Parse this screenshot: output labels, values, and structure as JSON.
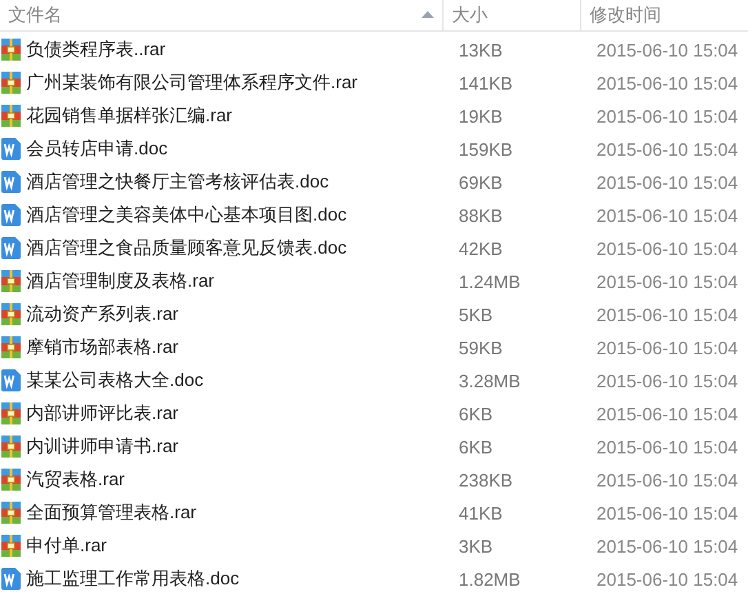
{
  "columns": [
    {
      "label": "文件名",
      "sorted": true
    },
    {
      "label": "大小",
      "sorted": false
    },
    {
      "label": "修改时间",
      "sorted": false
    }
  ],
  "files": [
    {
      "name": "负债类程序表..rar",
      "kind": "rar",
      "size": "13KB",
      "modified": "2015-06-10 15:04"
    },
    {
      "name": "广州某装饰有限公司管理体系程序文件.rar",
      "kind": "rar",
      "size": "141KB",
      "modified": "2015-06-10 15:04"
    },
    {
      "name": "花园销售单据样张汇编.rar",
      "kind": "rar",
      "size": "19KB",
      "modified": "2015-06-10 15:04"
    },
    {
      "name": "会员转店申请.doc",
      "kind": "doc",
      "size": "159KB",
      "modified": "2015-06-10 15:04"
    },
    {
      "name": "酒店管理之快餐厅主管考核评估表.doc",
      "kind": "doc",
      "size": "69KB",
      "modified": "2015-06-10 15:04"
    },
    {
      "name": "酒店管理之美容美体中心基本项目图.doc",
      "kind": "doc",
      "size": "88KB",
      "modified": "2015-06-10 15:04"
    },
    {
      "name": "酒店管理之食品质量顾客意见反馈表.doc",
      "kind": "doc",
      "size": "42KB",
      "modified": "2015-06-10 15:04"
    },
    {
      "name": "酒店管理制度及表格.rar",
      "kind": "rar",
      "size": "1.24MB",
      "modified": "2015-06-10 15:04"
    },
    {
      "name": "流动资产系列表.rar",
      "kind": "rar",
      "size": "5KB",
      "modified": "2015-06-10 15:04"
    },
    {
      "name": "摩销市场部表格.rar",
      "kind": "rar",
      "size": "59KB",
      "modified": "2015-06-10 15:04"
    },
    {
      "name": "某某公司表格大全.doc",
      "kind": "doc",
      "size": "3.28MB",
      "modified": "2015-06-10 15:04"
    },
    {
      "name": "内部讲师评比表.rar",
      "kind": "rar",
      "size": "6KB",
      "modified": "2015-06-10 15:04"
    },
    {
      "name": "内训讲师申请书.rar",
      "kind": "rar",
      "size": "6KB",
      "modified": "2015-06-10 15:04"
    },
    {
      "name": "汽贸表格.rar",
      "kind": "rar",
      "size": "238KB",
      "modified": "2015-06-10 15:04"
    },
    {
      "name": "全面预算管理表格.rar",
      "kind": "rar",
      "size": "41KB",
      "modified": "2015-06-10 15:04"
    },
    {
      "name": "申付单.rar",
      "kind": "rar",
      "size": "3KB",
      "modified": "2015-06-10 15:04"
    },
    {
      "name": "施工监理工作常用表格.doc",
      "kind": "doc",
      "size": "1.82MB",
      "modified": "2015-06-10 15:04"
    }
  ]
}
